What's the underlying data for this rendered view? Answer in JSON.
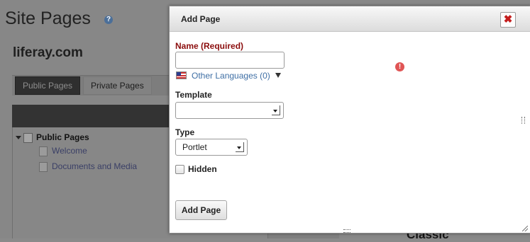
{
  "background": {
    "site_title": "Site Pages",
    "site_name": "liferay.com",
    "tabs": [
      {
        "label": "Public Pages"
      },
      {
        "label": "Private Pages"
      }
    ],
    "tree": {
      "root_label": "Public Pages",
      "children": [
        {
          "label": "Welcome"
        },
        {
          "label": "Documents and Media"
        }
      ]
    },
    "partial_theme_label": "Classic"
  },
  "dialog": {
    "title": "Add Page",
    "name_label": "Name (Required)",
    "name_value": "",
    "other_languages_label": "Other Languages (0)",
    "template_label": "Template",
    "template_value": "",
    "type_label": "Type",
    "type_value": "Portlet",
    "hidden_label": "Hidden",
    "hidden_checked": false,
    "submit_label": "Add Page"
  },
  "colors": {
    "required_label": "#8b0d0d",
    "link": "#3f6fa5",
    "close": "#c41d1d",
    "error": "#e05555"
  },
  "icons": {
    "help": "help-icon",
    "close": "close-icon",
    "flag": "us-flag-icon",
    "error": "error-icon"
  }
}
